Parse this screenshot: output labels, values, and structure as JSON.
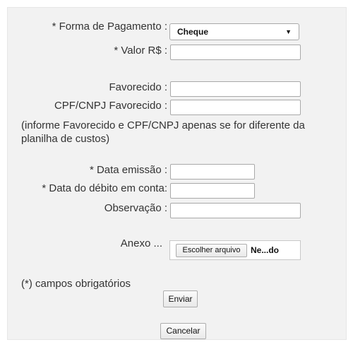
{
  "form": {
    "payment_method_label": "* Forma de Pagamento :",
    "payment_method_value": "Cheque",
    "amount_label": "* Valor R$ :",
    "payee_label": "Favorecido :",
    "payee_doc_label": "CPF/CNPJ Favorecido :",
    "payee_note": "(informe Favorecido e CPF/CNPJ apenas se for diferente da planilha de custos)",
    "issue_date_label": "* Data emissão :",
    "debit_date_label": "* Data do débito em conta:",
    "observation_label": "Observação :",
    "attachment_label": "Anexo ...",
    "choose_file_button": "Escolher arquivo",
    "file_name": "Ne...do",
    "required_note": "(*) campos obrigatórios",
    "submit_button": "Enviar",
    "cancel_button": "Cancelar"
  },
  "icons": {
    "select_arrow": "chevron-down-icon"
  }
}
